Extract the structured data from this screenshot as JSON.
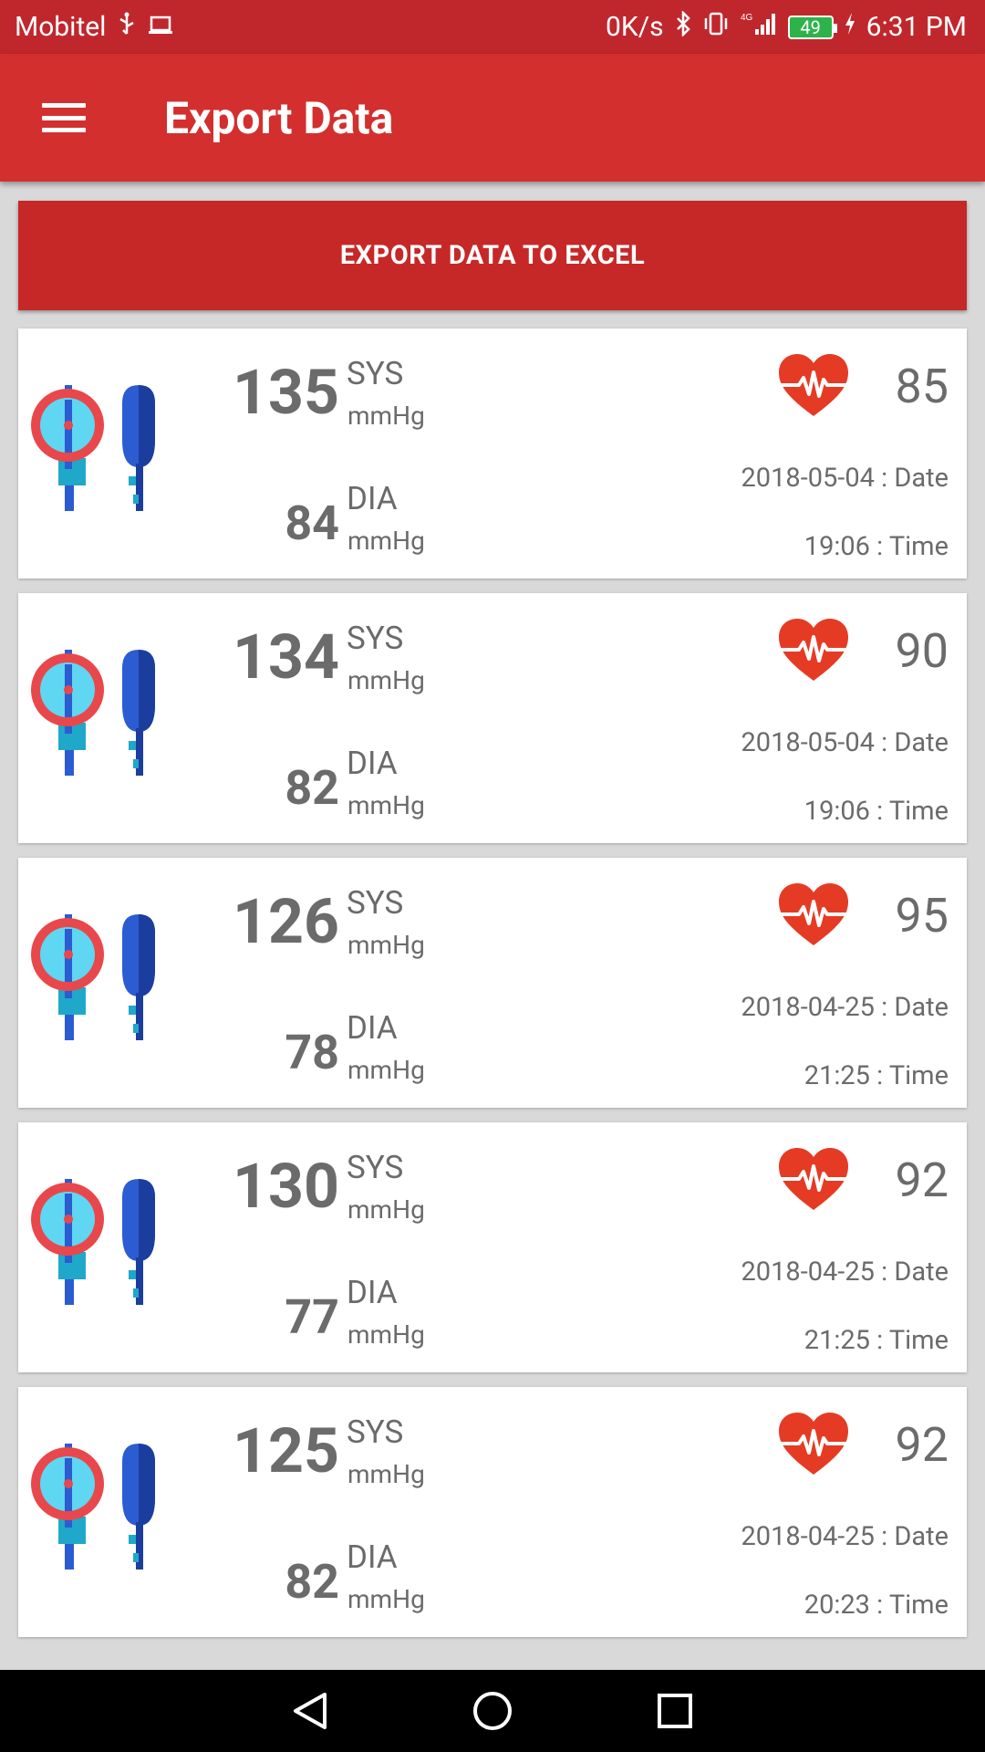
{
  "status_bar": {
    "carrier": "Mobitel",
    "net_speed": "0K/s",
    "network": "4G",
    "battery": "49",
    "time": "6:31 PM"
  },
  "app_bar": {
    "title": "Export Data",
    "menu_icon": "hamburger-menu-icon"
  },
  "export_button": {
    "label": "EXPORT DATA TO EXCEL",
    "color": "#c62828"
  },
  "readings": [
    {
      "sys": "135",
      "sys_label": "SYS",
      "sys_unit": "mmHg",
      "dia": "84",
      "dia_label": "DIA",
      "dia_unit": "mmHg",
      "pulse": "85",
      "date": "2018-05-04 : Date",
      "time": "19:06 : Time"
    },
    {
      "sys": "134",
      "sys_label": "SYS",
      "sys_unit": "mmHg",
      "dia": "82",
      "dia_label": "DIA",
      "dia_unit": "mmHg",
      "pulse": "90",
      "date": "2018-05-04 : Date",
      "time": "19:06 : Time"
    },
    {
      "sys": "126",
      "sys_label": "SYS",
      "sys_unit": "mmHg",
      "dia": "78",
      "dia_label": "DIA",
      "dia_unit": "mmHg",
      "pulse": "95",
      "date": "2018-04-25 : Date",
      "time": "21:25 : Time"
    },
    {
      "sys": "130",
      "sys_label": "SYS",
      "sys_unit": "mmHg",
      "dia": "77",
      "dia_label": "DIA",
      "dia_unit": "mmHg",
      "pulse": "92",
      "date": "2018-04-25 : Date",
      "time": "21:25 : Time"
    },
    {
      "sys": "125",
      "sys_label": "SYS",
      "sys_unit": "mmHg",
      "dia": "82",
      "dia_label": "DIA",
      "dia_unit": "mmHg",
      "pulse": "92",
      "date": "2018-04-25 : Date",
      "time": "20:23 : Time"
    }
  ],
  "colors": {
    "primary": "#d32f2f",
    "status_bar": "#c0272d",
    "heart": "#e53b24",
    "text": "#6b6b6b"
  },
  "nav_bar": {
    "back_icon": "back-triangle-icon",
    "home_icon": "home-circle-icon",
    "recents_icon": "recents-square-icon"
  }
}
